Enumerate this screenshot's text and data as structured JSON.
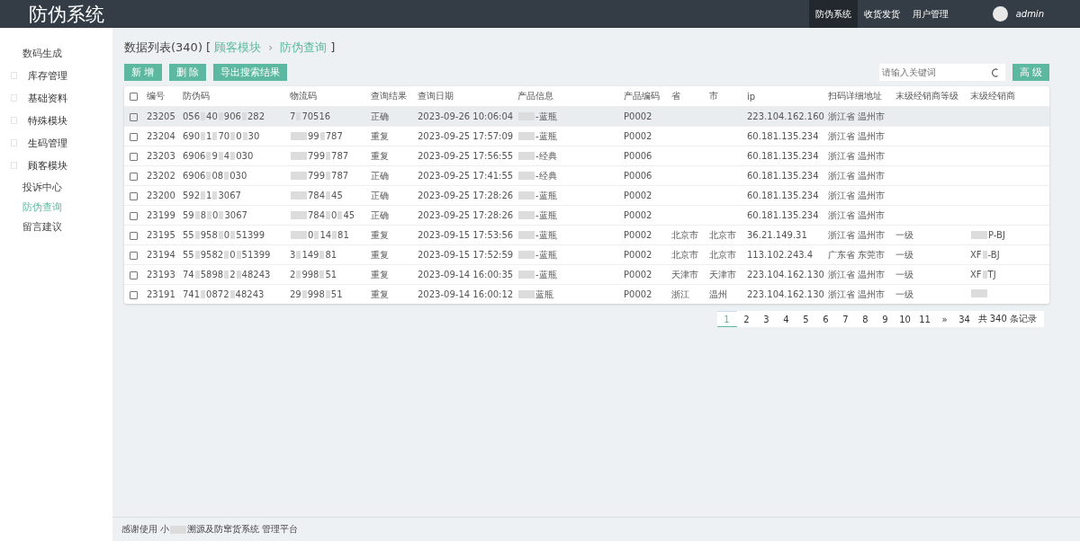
{
  "app_title": "防伪系统",
  "top_nav": [
    {
      "label": "防伪系统",
      "selected": true
    },
    {
      "label": "收货发货",
      "selected": false
    },
    {
      "label": "用户管理",
      "selected": false
    }
  ],
  "user": {
    "name": "admin"
  },
  "sidebar": {
    "items": [
      {
        "kind": "link",
        "label": "数码生成",
        "selected": false
      },
      {
        "kind": "group",
        "label": "库存管理",
        "selected": false
      },
      {
        "kind": "group",
        "label": "基础资料",
        "selected": false
      },
      {
        "kind": "group",
        "label": "特殊模块",
        "selected": false
      },
      {
        "kind": "group",
        "label": "生码管理",
        "selected": false
      },
      {
        "kind": "group",
        "label": "顾客模块",
        "selected": false
      },
      {
        "kind": "link",
        "label": "投诉中心",
        "selected": false
      },
      {
        "kind": "link",
        "label": "防伪查询",
        "selected": true
      },
      {
        "kind": "link",
        "label": "留言建议",
        "selected": false
      }
    ]
  },
  "breadcrumb": {
    "title": "数据列表(340)",
    "open": "[",
    "parent": "顾客模块",
    "separator": "›",
    "current": "防伪查询",
    "close": "]"
  },
  "toolbar": {
    "buttons": [
      "新 增",
      "删 除",
      "导出搜索结果"
    ],
    "search": {
      "placeholder": "请输入关键词"
    },
    "advanced": "高 级"
  },
  "table": {
    "select_all_checked": false,
    "columns": [
      "编号",
      "防伪码",
      "物流码",
      "查询结果",
      "查询日期",
      "产品信息",
      "产品编码",
      "省",
      "市",
      "ip",
      "扫码详细地址",
      "末级经销商等级",
      "末级经销商"
    ],
    "rows": [
      {
        "hovered": true,
        "checked": false,
        "id": "23205",
        "code": {
          "parts": [
            "056",
            "40",
            "906",
            "282"
          ]
        },
        "logistics": {
          "parts": [
            "7",
            "70516"
          ]
        },
        "result": "正确",
        "date": "2023-09-26 10:06:04",
        "product": {
          "redacted_start": true,
          "parts": [
            "-蓝瓶"
          ]
        },
        "product_code": "P0002",
        "ip": "223.104.162.160",
        "address": "浙江省 温州市"
      },
      {
        "hovered": false,
        "checked": false,
        "id": "23204",
        "code": {
          "parts": [
            "690",
            "1",
            "70",
            "0",
            "30"
          ]
        },
        "logistics": {
          "redacted_start": true,
          "parts": [
            "99",
            "787"
          ]
        },
        "result": "重复",
        "date": "2023-09-25 17:57:09",
        "product": {
          "redacted_start": true,
          "parts": [
            "-蓝瓶"
          ]
        },
        "product_code": "P0002",
        "ip": "60.181.135.234",
        "address": "浙江省 温州市"
      },
      {
        "hovered": false,
        "checked": false,
        "id": "23203",
        "code": {
          "parts": [
            "6906",
            "9",
            "4",
            "030"
          ]
        },
        "logistics": {
          "redacted_start": true,
          "parts": [
            "799",
            "787"
          ]
        },
        "result": "重复",
        "date": "2023-09-25 17:56:55",
        "product": {
          "redacted_start": true,
          "parts": [
            "-经典"
          ]
        },
        "product_code": "P0006",
        "ip": "60.181.135.234",
        "address": "浙江省 温州市"
      },
      {
        "hovered": false,
        "checked": false,
        "id": "23202",
        "code": {
          "parts": [
            "6906",
            "08",
            "030"
          ]
        },
        "logistics": {
          "redacted_start": true,
          "parts": [
            "799",
            "787"
          ]
        },
        "result": "正确",
        "date": "2023-09-25 17:41:55",
        "product": {
          "redacted_start": true,
          "parts": [
            "-经典"
          ]
        },
        "product_code": "P0006",
        "ip": "60.181.135.234",
        "address": "浙江省 温州市"
      },
      {
        "hovered": false,
        "checked": false,
        "id": "23200",
        "code": {
          "parts": [
            "592",
            "1",
            "3067"
          ]
        },
        "logistics": {
          "redacted_start": true,
          "parts": [
            "784",
            "45"
          ]
        },
        "result": "正确",
        "date": "2023-09-25 17:28:26",
        "product": {
          "redacted_start": true,
          "parts": [
            "-蓝瓶"
          ]
        },
        "product_code": "P0002",
        "ip": "60.181.135.234",
        "address": "浙江省 温州市"
      },
      {
        "hovered": false,
        "checked": false,
        "id": "23199",
        "code": {
          "parts": [
            "59",
            "8",
            "0",
            "3067"
          ]
        },
        "logistics": {
          "redacted_start": true,
          "parts": [
            "784",
            "0",
            "45"
          ]
        },
        "result": "正确",
        "date": "2023-09-25 17:28:26",
        "product": {
          "redacted_start": true,
          "parts": [
            "-蓝瓶"
          ]
        },
        "product_code": "P0002",
        "ip": "60.181.135.234",
        "address": "浙江省 温州市"
      },
      {
        "hovered": false,
        "checked": false,
        "id": "23195",
        "code": {
          "parts": [
            "55",
            "958",
            "0",
            "51399"
          ]
        },
        "logistics": {
          "redacted_start": true,
          "parts": [
            "0",
            "14",
            "81"
          ]
        },
        "result": "重复",
        "date": "2023-09-15 17:53:56",
        "product": {
          "redacted_start": true,
          "parts": [
            "-蓝瓶"
          ]
        },
        "product_code": "P0002",
        "province": "北京市",
        "city": "北京市",
        "ip": "36.21.149.31",
        "address": "浙江省 温州市",
        "dealer_level": "一级",
        "dealer": {
          "redacted_start": true,
          "parts": [
            "P-BJ"
          ]
        }
      },
      {
        "hovered": false,
        "checked": false,
        "id": "23194",
        "code": {
          "parts": [
            "55",
            "9582",
            "0",
            "51399"
          ]
        },
        "logistics": {
          "parts": [
            "3",
            "149",
            "81"
          ]
        },
        "result": "重复",
        "date": "2023-09-15 17:52:59",
        "product": {
          "redacted_start": true,
          "parts": [
            "-蓝瓶"
          ]
        },
        "product_code": "P0002",
        "province": "北京市",
        "city": "北京市",
        "ip": "113.102.243.4",
        "address": "广东省 东莞市",
        "dealer_level": "一级",
        "dealer": {
          "parts": [
            "XF",
            "-BJ"
          ]
        }
      },
      {
        "hovered": false,
        "checked": false,
        "id": "23193",
        "code": {
          "parts": [
            "74",
            "5898",
            "2",
            "48243"
          ]
        },
        "logistics": {
          "parts": [
            "2",
            "998",
            "51"
          ]
        },
        "result": "重复",
        "date": "2023-09-14 16:00:35",
        "product": {
          "redacted_start": true,
          "parts": [
            "-蓝瓶"
          ]
        },
        "product_code": "P0002",
        "province": "天津市",
        "city": "天津市",
        "ip": "223.104.162.130",
        "address": "浙江省 温州市",
        "dealer_level": "一级",
        "dealer": {
          "parts": [
            "XF",
            "TJ"
          ]
        }
      },
      {
        "hovered": false,
        "checked": false,
        "id": "23191",
        "code": {
          "parts": [
            "741",
            "0872",
            "48243"
          ]
        },
        "logistics": {
          "parts": [
            "29",
            "998",
            "51"
          ]
        },
        "result": "重复",
        "date": "2023-09-14 16:00:12",
        "product": {
          "redacted_start": true,
          "parts": [
            "蓝瓶"
          ]
        },
        "product_code": "P0002",
        "province": "浙江",
        "city": "温州",
        "ip": "223.104.162.130",
        "address": "浙江省 温州市",
        "dealer_level": "一级",
        "dealer": {
          "redacted_start": true
        }
      }
    ]
  },
  "pagination": {
    "pages": [
      {
        "label": "1",
        "selected": true
      },
      {
        "label": "2",
        "selected": false
      },
      {
        "label": "3",
        "selected": false
      },
      {
        "label": "4",
        "selected": false
      },
      {
        "label": "5",
        "selected": false
      },
      {
        "label": "6",
        "selected": false
      },
      {
        "label": "7",
        "selected": false
      },
      {
        "label": "8",
        "selected": false
      },
      {
        "label": "9",
        "selected": false
      },
      {
        "label": "10",
        "selected": false
      },
      {
        "label": "11",
        "selected": false
      },
      {
        "label": "»",
        "selected": false
      },
      {
        "label": "34",
        "selected": false
      }
    ],
    "total": "共 340 条记录"
  },
  "footer": {
    "parts": [
      "感谢使用 小",
      "溯源及防窜货系统 管理平台"
    ]
  }
}
